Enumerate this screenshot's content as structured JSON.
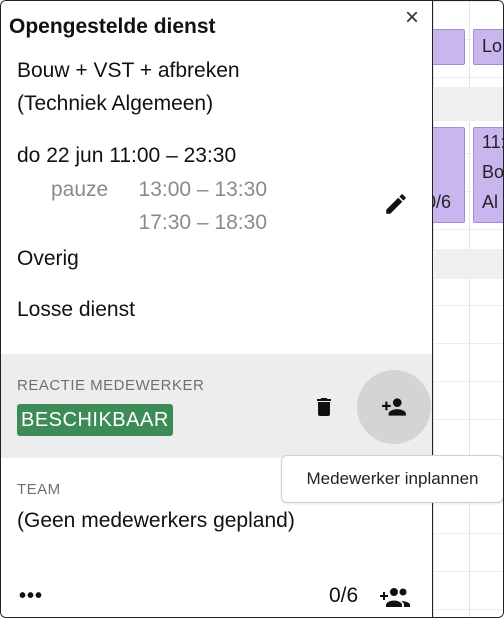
{
  "popup": {
    "title": "Opengestelde dienst",
    "close_icon": "×",
    "shift_name": "Bouw + VST + afbreken",
    "department": "(Techniek Algemeen)",
    "datetime": "do 22 jun 11:00 – 23:30",
    "break_label": "pauze",
    "breaks": [
      "13:00 – 13:30",
      "17:30 – 18:30"
    ],
    "category": "Overig",
    "shift_type": "Losse dienst",
    "reaction_label": "REACTIE MEDEWERKER",
    "reaction_status": "BESCHIKBAAR",
    "reaction_status_color": "#3d8b56",
    "team_label": "TEAM",
    "team_value": "(Geen medewerkers gepland)",
    "more_label": "•••",
    "count": "0/6",
    "tooltip": "Medewerker inplannen"
  },
  "calendar_background": {
    "event_top_text": "Lo",
    "event_right_lines": [
      "11:",
      "Bo",
      "Al"
    ],
    "event_left_text": "0/6",
    "event_color": "#c9b6ee"
  }
}
